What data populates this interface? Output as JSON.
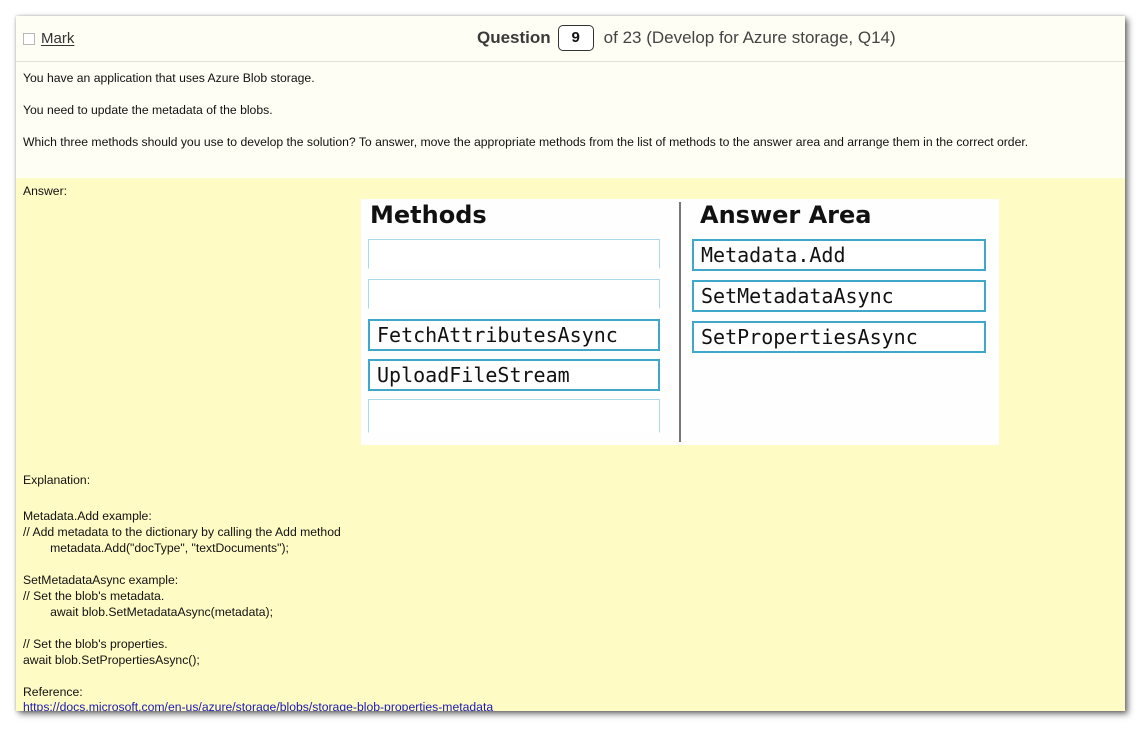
{
  "header": {
    "mark_label": "Mark",
    "question_word": "Question",
    "question_number": "9",
    "question_total_text": "of 23 (Develop for Azure storage, Q14)"
  },
  "question": {
    "line1": "You have an application that uses Azure Blob storage.",
    "line2": "You need to update the metadata of the blobs.",
    "line3": "Which three methods should you use to develop the solution? To answer, move the appropriate methods from the list of methods to the answer area and arrange them in the correct order."
  },
  "answer": {
    "label": "Answer:",
    "exhibit": {
      "methods_title": "Methods",
      "answer_title": "Answer Area",
      "methods": [
        "",
        "",
        "FetchAttributesAsync",
        "UploadFileStream",
        ""
      ],
      "answers": [
        "Metadata.Add",
        "SetMetadataAsync",
        "SetPropertiesAsync"
      ]
    },
    "explanation_label": "Explanation:",
    "explanation": {
      "l1": "Metadata.Add example:",
      "l2": "// Add metadata to the dictionary by calling the Add method",
      "l3": "        metadata.Add(\"docType\", \"textDocuments\");",
      "l4": "SetMetadataAsync example:",
      "l5": "// Set the blob's metadata.",
      "l6": "        await blob.SetMetadataAsync(metadata);",
      "l7": "// Set the blob's properties.",
      "l8": "await blob.SetPropertiesAsync();",
      "l9": "Reference:"
    },
    "reference_url": "https://docs.microsoft.com/en-us/azure/storage/blobs/storage-blob-properties-metadata"
  }
}
